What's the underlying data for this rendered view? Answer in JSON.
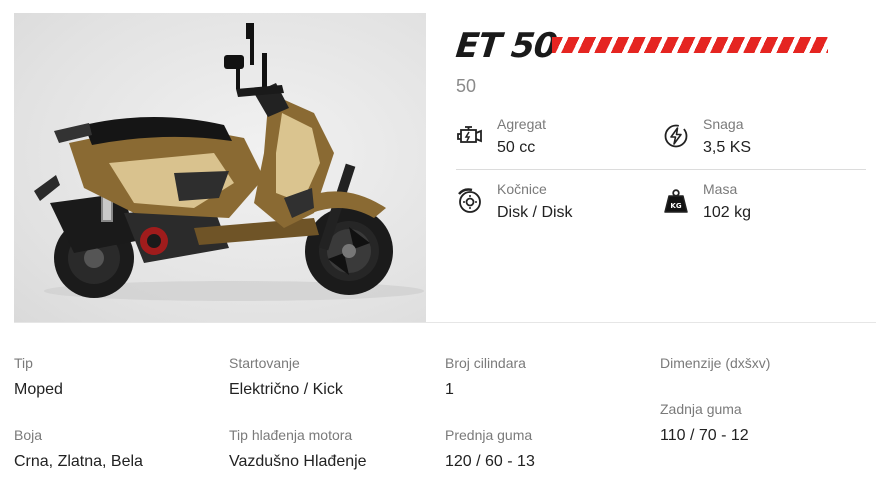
{
  "product": {
    "title": "ET 50",
    "subtitle": "50",
    "image_icon": "scooter-photo",
    "accent_color": "#e52521"
  },
  "key_specs": [
    {
      "label": "Agregat",
      "value": "50 cc",
      "icon": "engine-icon"
    },
    {
      "label": "Snaga",
      "value": "3,5 KS",
      "icon": "lightning-icon"
    },
    {
      "label": "Kočnice",
      "value": "Disk / Disk",
      "icon": "brake-disc-icon"
    },
    {
      "label": "Masa",
      "value": "102 kg",
      "icon": "weight-icon"
    }
  ],
  "details": {
    "tip": {
      "label": "Tip",
      "value": "Moped"
    },
    "startovanje": {
      "label": "Startovanje",
      "value": "Električno / Kick"
    },
    "broj_cilindara": {
      "label": "Broj cilindara",
      "value": "1"
    },
    "dimenzije": {
      "label": "Dimenzije (dxšxv)",
      "value": ""
    },
    "boja": {
      "label": "Boja",
      "value": "Crna, Zlatna, Bela"
    },
    "hladjenje": {
      "label": "Tip hlađenja motora",
      "value": "Vazdušno Hlađenje"
    },
    "prednja_guma": {
      "label": "Prednja guma",
      "value": "120 / 60 - 13"
    },
    "zadnja_guma": {
      "label": "Zadnja guma",
      "value": "110 / 70 - 12"
    }
  }
}
